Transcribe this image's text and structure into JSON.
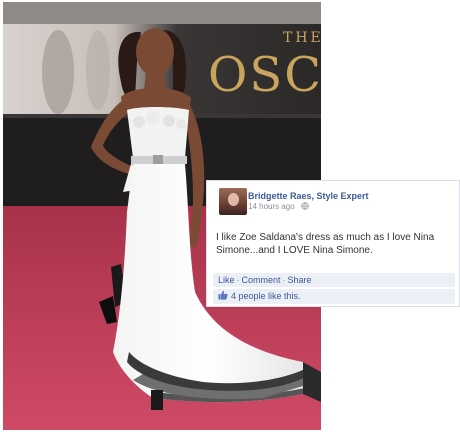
{
  "photo": {
    "backdrop_the": "THE",
    "backdrop_oscars": "OSCA"
  },
  "comment": {
    "author": "Bridgette Raes, Style Expert",
    "timestamp": "14 hours ago",
    "text": "I like Zoe Saldana's dress as much as I love Nina Simone...and I LOVE Nina Simone.",
    "actions": {
      "like": "Like",
      "comment": "Comment",
      "share": "Share",
      "separator": "·"
    },
    "likes": "4 people like this."
  },
  "colors": {
    "link": "#3b5998",
    "carpet": "#c03c58",
    "action_bar_bg": "#eceff5"
  },
  "icons": {
    "globe": "globe-icon",
    "thumb": "thumbs-up-icon"
  }
}
